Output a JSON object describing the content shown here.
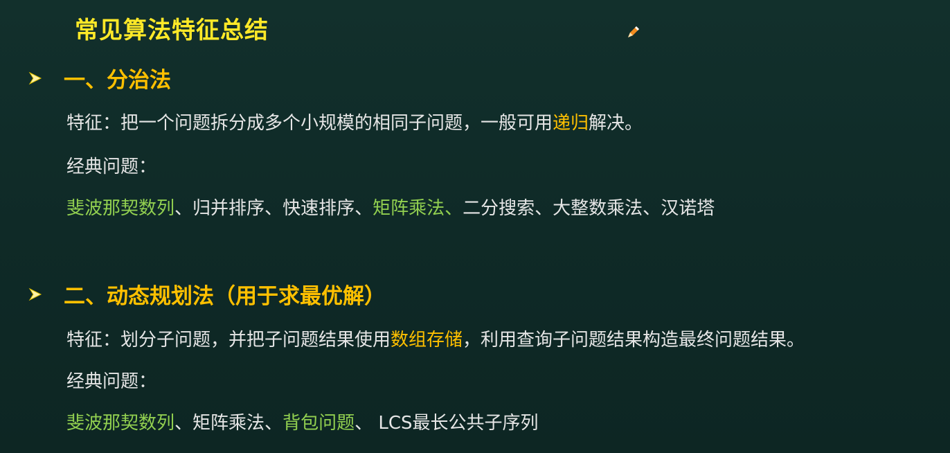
{
  "title": "常见算法特征总结",
  "colors": {
    "background": "#0f2a27",
    "title": "#ffe928",
    "section_heading": "#ffc000",
    "highlight_yellow": "#ffc000",
    "highlight_green": "#92d050",
    "body_text": "#e6e6e6"
  },
  "icons": {
    "pencil": "pencil-icon",
    "bullet": "arrow-bullet-icon"
  },
  "sections": [
    {
      "heading": "一、分治法",
      "feature_prefix": "特征：把一个问题拆分成多个小规模的相同子问题，一般可用",
      "feature_highlight": "递归",
      "feature_suffix": "解决。",
      "problems_label": "经典问题：",
      "problems": [
        {
          "text": "斐波那契数列",
          "sep": "、",
          "highlight": "green"
        },
        {
          "text": "归并排序",
          "sep": "、",
          "highlight": "none"
        },
        {
          "text": "快速排序",
          "sep": "、",
          "highlight": "none"
        },
        {
          "text": "矩阵乘法",
          "sep": "、",
          "highlight": "green"
        },
        {
          "text": "二分搜索",
          "sep": "、",
          "highlight": "none"
        },
        {
          "text": "大整数乘法",
          "sep": "、",
          "highlight": "none"
        },
        {
          "text": "汉诺塔",
          "sep": "",
          "highlight": "none"
        }
      ]
    },
    {
      "heading": "二、动态规划法（用于求最优解）",
      "feature_prefix": "特征：划分子问题，并把子问题结果使用",
      "feature_highlight": "数组存储",
      "feature_suffix": "，利用查询子问题结果构造最终问题结果。",
      "problems_label": "经典问题：",
      "problems": [
        {
          "text": "斐波那契数列",
          "sep": "、",
          "highlight": "green"
        },
        {
          "text": "矩阵乘法",
          "sep": "、",
          "highlight": "none"
        },
        {
          "text": "背包问题",
          "sep": "、 ",
          "highlight": "green"
        },
        {
          "text": "LCS最长公共子序列",
          "sep": "",
          "highlight": "none"
        }
      ]
    }
  ]
}
